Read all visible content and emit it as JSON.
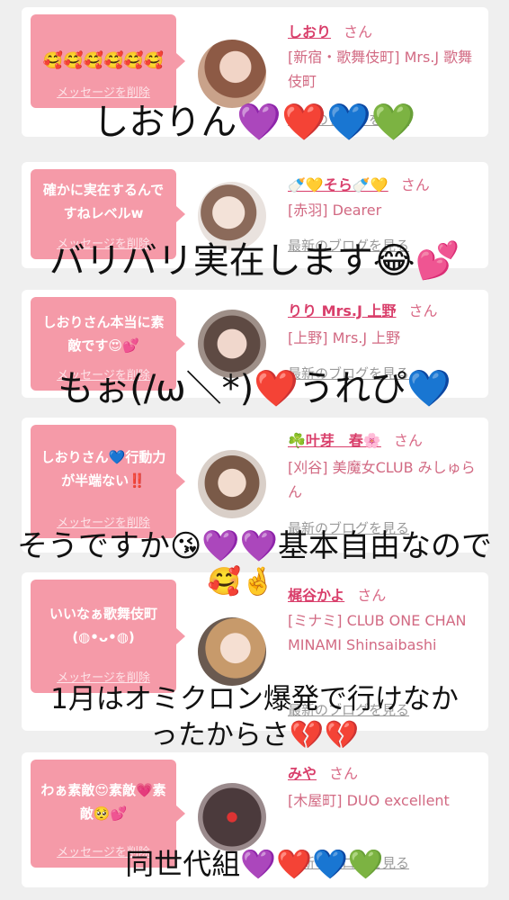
{
  "cards": [
    {
      "message": "🥰🥰🥰🥰🥰🥰",
      "delete_label": "メッセージを削除",
      "name": "しおり",
      "san": "さん",
      "shop": "[新宿・歌舞伎町] Mrs.J 歌舞伎町",
      "blog": "最新のブログを見る",
      "avatar_color": "#c78f73"
    },
    {
      "message": "確かに実在するんですねレベルw",
      "delete_label": "メッセージを削除",
      "name": "🍼💛そら🍼💛",
      "san": "さん",
      "shop": "[赤羽] Dearer",
      "blog": "最新のブログを見る",
      "avatar_color": "#d8c4b8"
    },
    {
      "message": "しおりさん本当に素敵です😍💕",
      "delete_label": "メッセージを削除",
      "name": "りり Mrs.J 上野",
      "san": "さん",
      "shop": "[上野] Mrs.J 上野",
      "blog": "最新のブログを見る",
      "avatar_color": "#6b5a52"
    },
    {
      "message": "しおりさん💙行動力が半端ない‼️",
      "delete_label": "メッセージを削除",
      "name": "☘️叶芽　春🌸",
      "san": "さん",
      "shop": "[刈谷] 美魔女CLUB みしゅらん",
      "blog": "最新のブログを見る",
      "avatar_color": "#cdb7a6"
    },
    {
      "message": "いいなぁ歌舞伎町(◍•ᴗ•◍)",
      "delete_label": "メッセージを削除",
      "name": "梶谷かよ",
      "san": "さん",
      "shop": "[ミナミ] CLUB ONE CHAN MINAMI Shinsaibashi",
      "blog": "最新のブログを見る",
      "avatar_color": "#caa07c"
    },
    {
      "message": "わぁ素敵😍素敵💗素敵🥺💕",
      "delete_label": "メッセージを削除",
      "name": "みや",
      "san": "さん",
      "shop": "[木屋町] DUO excellent",
      "blog": "最新のブログを見る",
      "avatar_color": "#4a3a3c"
    }
  ],
  "overlay_texts": [
    "しおりん💜❤️💙💚",
    "バリバリ実在します😂💕",
    "もぉ(/ω＼*)❤️うれぴ💙",
    "そうですか😘💜💜基本自由なので",
    "🥰🤞",
    "1月はオミクロン爆発で行けなか",
    "ったからさ💔💔",
    "同世代組💜❤️💙💚"
  ],
  "colors": {
    "bubble": "#f59aa8",
    "name": "#d93f6b",
    "shop": "#d26a83",
    "background": "#efefef"
  }
}
